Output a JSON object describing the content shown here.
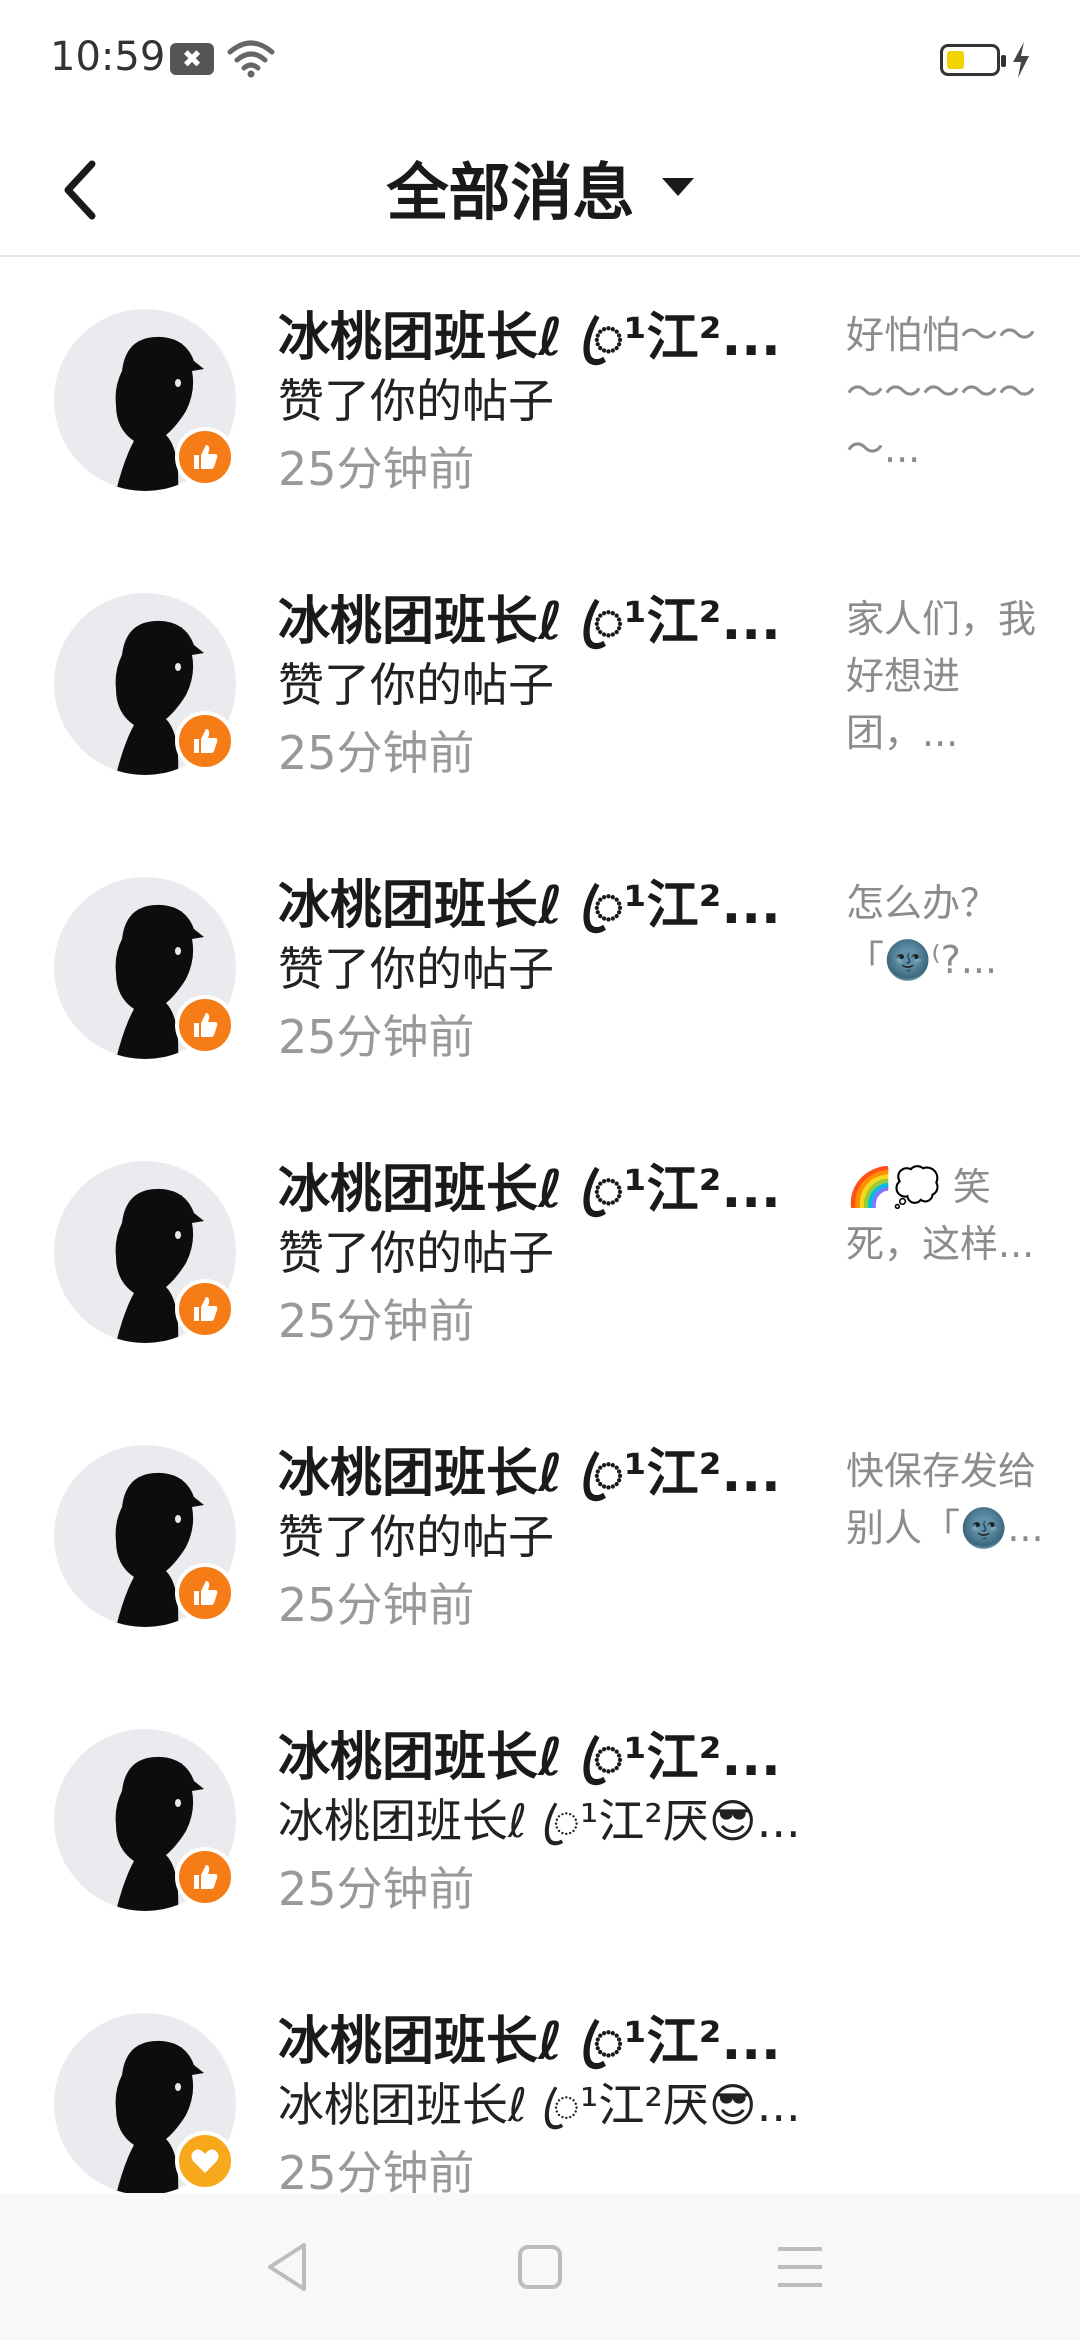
{
  "status_bar": {
    "time": "10:59",
    "notif_glyph": "✖",
    "battery_level": 0.35
  },
  "header": {
    "title": "全部消息"
  },
  "messages": [
    {
      "name": "冰桃团班长ℓ ꦿ¹江²...",
      "action": "赞了你的帖子",
      "time": "25分钟前",
      "preview": "好怕怕～～～～～～～～...",
      "badge": "like"
    },
    {
      "name": "冰桃团班长ℓ ꦿ¹江²...",
      "action": "赞了你的帖子",
      "time": "25分钟前",
      "preview": "家人们，我好想进团，...",
      "badge": "like"
    },
    {
      "name": "冰桃团班长ℓ ꦿ¹江²...",
      "action": "赞了你的帖子",
      "time": "25分钟前",
      "preview": "怎么办？「🌚⁽?...",
      "badge": "like"
    },
    {
      "name": "冰桃团班长ℓ ꦿ¹江²...",
      "action": "赞了你的帖子",
      "time": "25分钟前",
      "preview": "🌈💭 笑死，这样...",
      "badge": "like"
    },
    {
      "name": "冰桃团班长ℓ ꦿ¹江²...",
      "action": "赞了你的帖子",
      "time": "25分钟前",
      "preview": "快保存发给别人「🌚...",
      "badge": "like"
    },
    {
      "name": "冰桃团班长ℓ ꦿ¹江²...",
      "action": "冰桃团班长ℓ ꦿ¹江²厌😎...",
      "time": "25分钟前",
      "preview": "",
      "badge": "like"
    },
    {
      "name": "冰桃团班长ℓ ꦿ¹江²...",
      "action": "冰桃团班长ℓ ꦿ¹江²厌😎...",
      "time": "25分钟前",
      "preview": "",
      "badge": "heart"
    }
  ],
  "colors": {
    "like_badge": "#f57c17",
    "heart_badge": "#f7a81b",
    "battery": "#f0d400"
  },
  "icons": {
    "back": "chevron-left-icon",
    "dropdown": "triangle-down-icon",
    "like": "thumbs-up-icon",
    "heart": "heart-icon",
    "nav_back": "triangle-back-icon",
    "nav_home": "square-home-icon",
    "nav_menu": "menu-lines-icon"
  }
}
